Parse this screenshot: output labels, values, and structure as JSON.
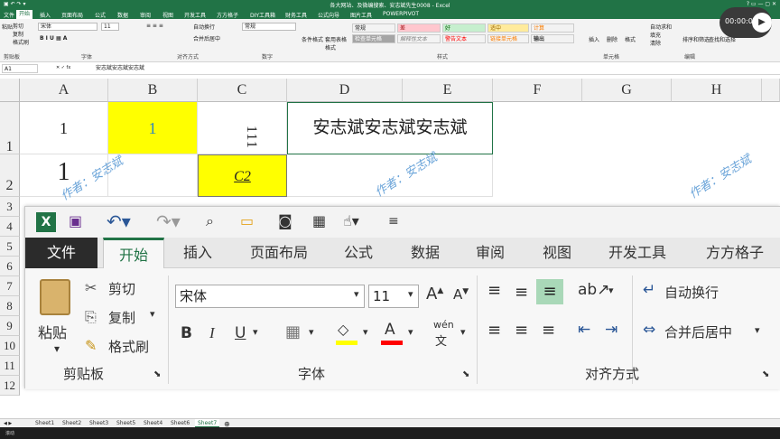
{
  "window": {
    "title": "各大网站、及微编搜索、安志斌先生0008 - Excel"
  },
  "ribbon_tabs": [
    {
      "label": "文件"
    },
    {
      "label": "开始"
    },
    {
      "label": "插入"
    },
    {
      "label": "页面布局"
    },
    {
      "label": "公式"
    },
    {
      "label": "数据"
    },
    {
      "label": "审阅"
    },
    {
      "label": "视图"
    },
    {
      "label": "开发工具"
    },
    {
      "label": "方方格子"
    },
    {
      "label": "DIY工具箱"
    },
    {
      "label": "财务工具"
    },
    {
      "label": "公式向导"
    },
    {
      "label": "图片工具"
    },
    {
      "label": "POWERPIVOT"
    }
  ],
  "small_ribbon": {
    "paste": "粘贴",
    "cut": "剪切",
    "copy": "复制",
    "format_painter": "格式刷",
    "font_name": "宋体",
    "font_size": "11",
    "wrap": "自动换行",
    "merge": "合并后居中",
    "number_format": "常规",
    "cond_format": "条件格式",
    "table_format": "套用表格格式",
    "styles": [
      {
        "label": "常规",
        "bg": "#ffffff",
        "fg": "#000000"
      },
      {
        "label": "差",
        "bg": "#ffc7ce",
        "fg": "#9c0006"
      },
      {
        "label": "好",
        "bg": "#c6efce",
        "fg": "#006100"
      },
      {
        "label": "适中",
        "bg": "#ffeb9c",
        "fg": "#9c6500"
      },
      {
        "label": "计算",
        "bg": "#f2f2f2",
        "fg": "#fa7d00"
      },
      {
        "label": "检查单元格",
        "bg": "#a5a5a5",
        "fg": "#ffffff"
      },
      {
        "label": "解释性文本",
        "bg": "#ffffff",
        "fg": "#7f7f7f"
      },
      {
        "label": "警告文本",
        "bg": "#ffffff",
        "fg": "#ff0000"
      },
      {
        "label": "链接单元格",
        "bg": "#ffffff",
        "fg": "#fa7d00"
      },
      {
        "label": "输出",
        "bg": "#f2f2f2",
        "fg": "#3f3f3f"
      }
    ],
    "insert": "插入",
    "delete": "删除",
    "format": "格式",
    "autosum": "自动求和",
    "fill": "填充",
    "clear": "清除",
    "sort_filter": "排序和筛选",
    "find_select": "查找和选择",
    "groups": {
      "clipboard": "剪贴板",
      "font": "字体",
      "alignment": "对齐方式",
      "number": "数字",
      "styles": "样式",
      "cells": "单元格",
      "editing": "编辑"
    }
  },
  "formula_bar": {
    "name_box": "A1",
    "content": "安志斌安志斌安志斌"
  },
  "grid": {
    "columns": [
      "A",
      "B",
      "C",
      "D",
      "E",
      "F",
      "G",
      "H"
    ],
    "rows": [
      "1",
      "2",
      "3",
      "4",
      "5",
      "6",
      "7",
      "8",
      "9",
      "10",
      "11",
      "12"
    ],
    "cells": {
      "A1": "1",
      "B1": "1",
      "C1": "111",
      "D1": "安志斌安志斌安志斌",
      "A2": "1",
      "C2": "C2"
    },
    "fill_yellow": "#ffff00",
    "watermark": "作者：安志斌"
  },
  "zoom_ribbon": {
    "tabs": [
      {
        "label": "文件"
      },
      {
        "label": "开始"
      },
      {
        "label": "插入"
      },
      {
        "label": "页面布局"
      },
      {
        "label": "公式"
      },
      {
        "label": "数据"
      },
      {
        "label": "审阅"
      },
      {
        "label": "视图"
      },
      {
        "label": "开发工具"
      },
      {
        "label": "方方格子"
      }
    ],
    "paste": "粘贴",
    "cut": "剪切",
    "copy": "复制",
    "format_painter": "格式刷",
    "font_name": "宋体",
    "font_size": "11",
    "wrap": "自动换行",
    "merge": "合并后居中",
    "group_clipboard": "剪贴板",
    "group_font": "字体",
    "group_alignment": "对齐方式",
    "phonetic": "wén",
    "accent": "#217346",
    "highlight_color": "#ffff00",
    "font_color": "#ff0000"
  },
  "sheet_tabs": [
    "Sheet1",
    "Sheet2",
    "Sheet3",
    "Sheet5",
    "Sheet4",
    "Sheet6",
    "Sheet7"
  ],
  "active_sheet": "Sheet7",
  "status": {
    "mode": "滚动"
  },
  "video": {
    "time": "00:00:00"
  }
}
